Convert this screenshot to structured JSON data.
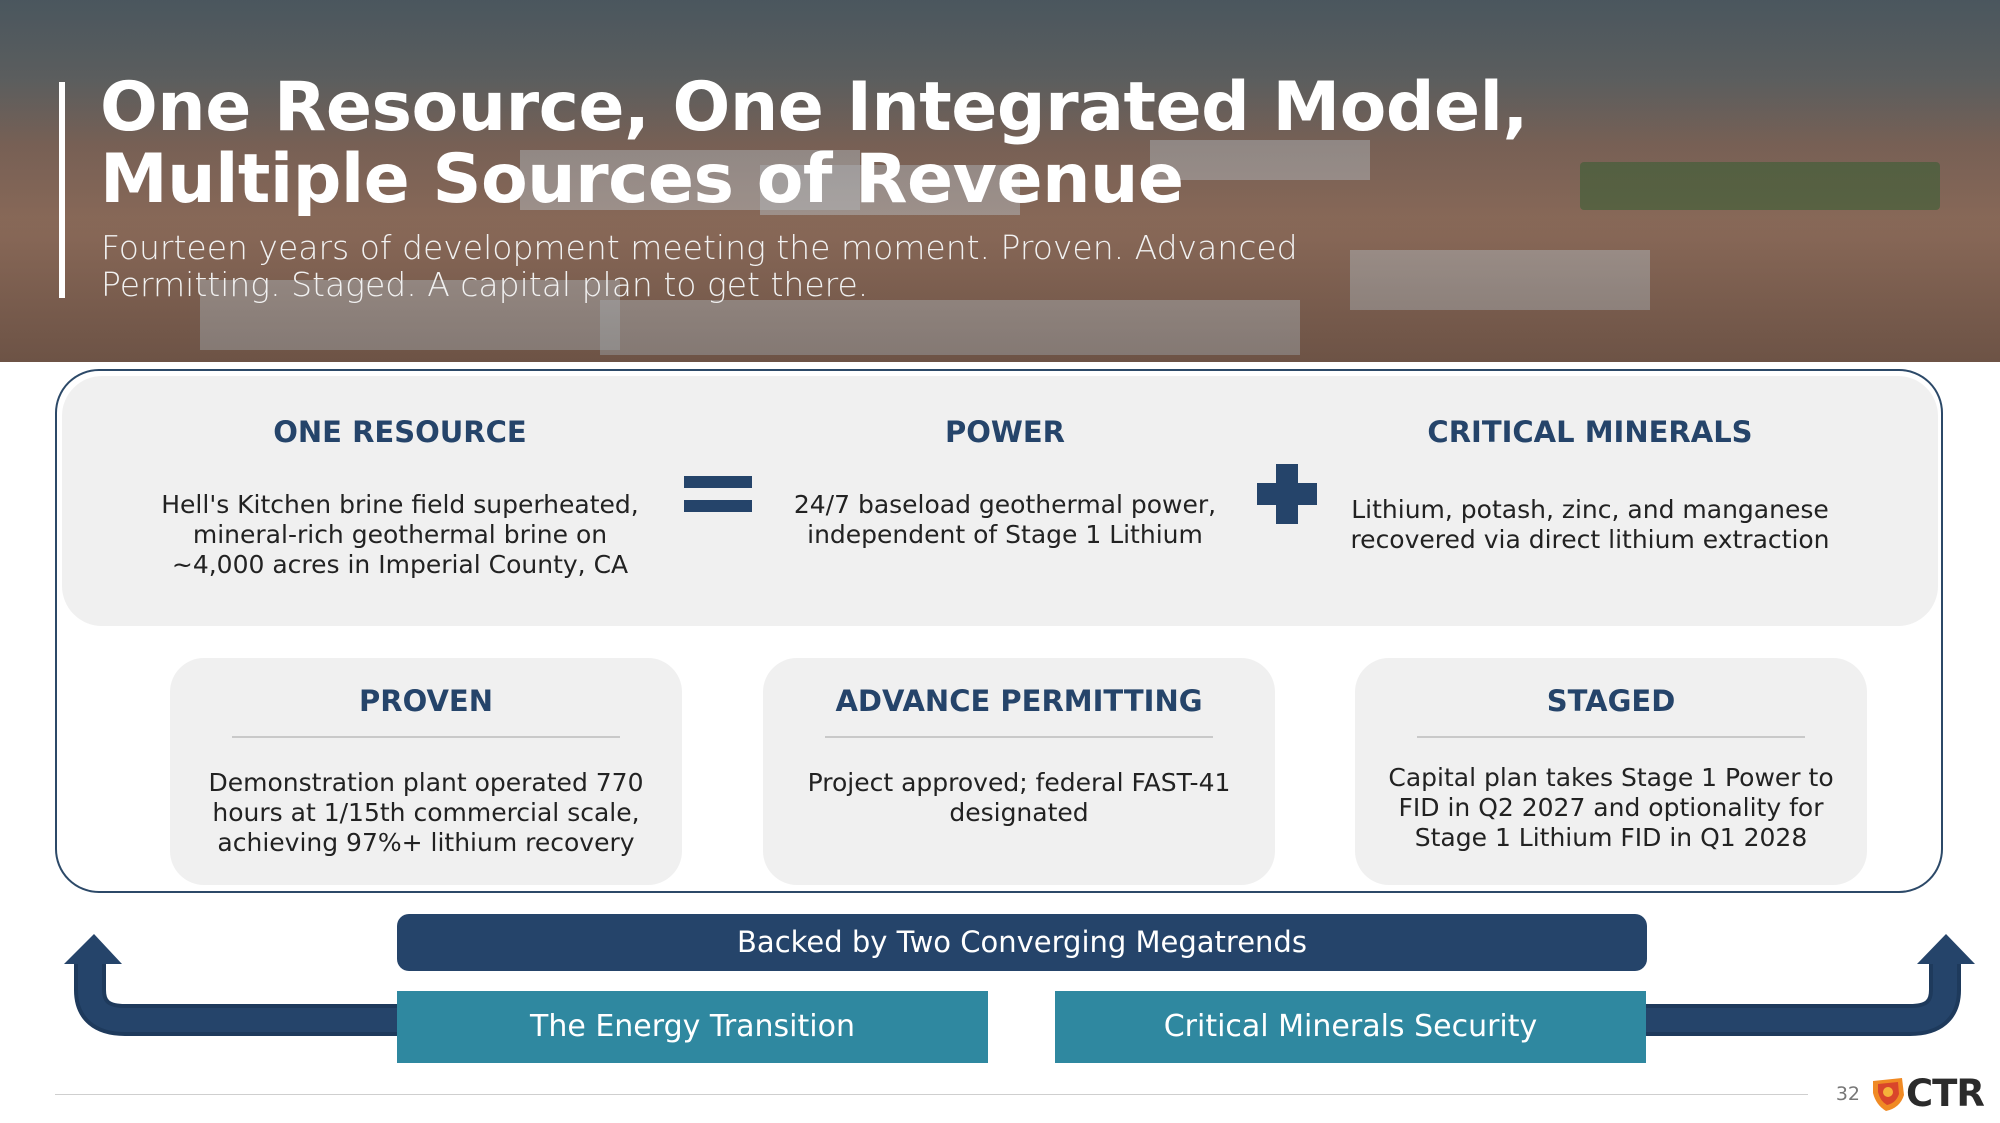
{
  "header": {
    "title": "One Resource, One Integrated Model, Multiple Sources of Revenue",
    "subtitle": "Fourteen years of development meeting the moment. Proven. Advanced Permitting. Staged. A capital plan to get there."
  },
  "equation": {
    "resource": {
      "title": "ONE RESOURCE",
      "text": "Hell's Kitchen brine field superheated, mineral-rich geothermal brine on ~4,000 acres in Imperial County, CA"
    },
    "equals_icon": "equals-icon",
    "power": {
      "title": "POWER",
      "text": "24/7 baseload geothermal power, independent of Stage 1 Lithium"
    },
    "plus_icon": "plus-icon",
    "minerals": {
      "title": "CRITICAL MINERALS",
      "text": "Lithium, potash, zinc, and manganese recovered via direct lithium extraction"
    }
  },
  "cards": [
    {
      "title": "PROVEN",
      "text": "Demonstration plant operated 770 hours at 1/15th commercial scale, achieving 97%+ lithium recovery"
    },
    {
      "title": "ADVANCE PERMITTING",
      "text": "Project approved; federal FAST-41 designated"
    },
    {
      "title": "STAGED",
      "text": "Capital plan takes Stage 1 Power to FID in Q2 2027 and optionality for Stage 1 Lithium FID in Q1 2028"
    }
  ],
  "megatrends": {
    "banner": "Backed by Two Converging Megatrends",
    "items": [
      "The Energy Transition",
      "Critical Minerals Security"
    ]
  },
  "footer": {
    "page_number": "32",
    "logo_text": "CTR"
  },
  "colors": {
    "navy": "#25446a",
    "teal": "#2f88a0",
    "card_gray": "#f0f0f0",
    "logo_orange": "#f08a24"
  }
}
